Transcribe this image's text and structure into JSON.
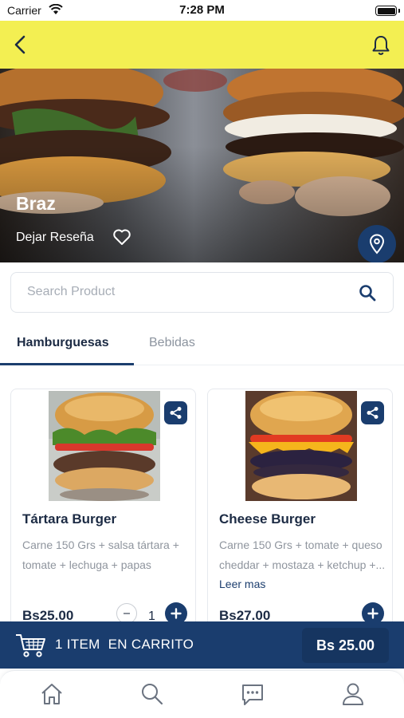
{
  "status_bar": {
    "carrier": "Carrier",
    "time": "7:28 PM"
  },
  "header": {
    "back_icon": "chevron-left-icon",
    "notification_icon": "bell-icon",
    "background_color": "#f3ef52"
  },
  "restaurant": {
    "name": "Braz",
    "review_label": "Dejar Reseña"
  },
  "search": {
    "placeholder": "Search Product",
    "value": ""
  },
  "tabs": [
    {
      "label": "Hamburguesas",
      "active": true
    },
    {
      "label": "Bebidas",
      "active": false
    }
  ],
  "products": [
    {
      "name": "Tártara Burger",
      "description": "Carne 150 Grs + salsa tártara + tomate + lechuga + papas",
      "read_more": "",
      "price": "Bs25.00",
      "quantity": "1"
    },
    {
      "name": "Cheese Burger",
      "description": "Carne 150 Grs + tomate + queso cheddar + mostaza + ketchup +...",
      "read_more": " Leer mas",
      "price": "Bs27.00",
      "quantity": ""
    }
  ],
  "cart": {
    "items_label": "1 ITEM  EN CARRITO",
    "total": "Bs 25.00"
  },
  "bottom_nav": [
    "home-icon",
    "search-icon",
    "chat-icon",
    "profile-icon"
  ],
  "colors": {
    "primary": "#1a3d6e",
    "accent_yellow": "#f3ef52",
    "call_green": "#2ed158"
  }
}
